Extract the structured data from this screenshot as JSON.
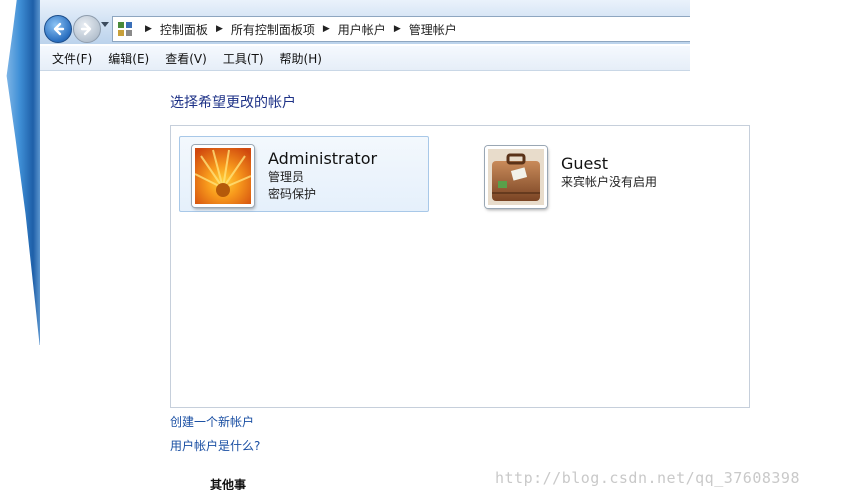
{
  "address": {
    "crumbs": [
      "控制面板",
      "所有控制面板项",
      "用户帐户",
      "管理帐户"
    ]
  },
  "menu": {
    "items": [
      "文件(F)",
      "编辑(E)",
      "查看(V)",
      "工具(T)",
      "帮助(H)"
    ]
  },
  "page": {
    "title": "选择希望更改的帐户"
  },
  "accounts": [
    {
      "name": "Administrator",
      "lines": [
        "管理员",
        "密码保护"
      ],
      "selected": true,
      "icon": "flower-avatar-icon"
    },
    {
      "name": "Guest",
      "lines": [
        "来宾帐户没有启用"
      ],
      "selected": false,
      "icon": "suitcase-avatar-icon"
    }
  ],
  "links": {
    "create": "创建一个新帐户",
    "what_is": "用户帐户是什么?"
  },
  "other": {
    "heading": "其他事"
  },
  "watermark": "http://blog.csdn.net/qq_37608398",
  "colors": {
    "link": "#1a4fa3",
    "title": "#1e3287",
    "selected_bg": "#e5f0fb"
  }
}
